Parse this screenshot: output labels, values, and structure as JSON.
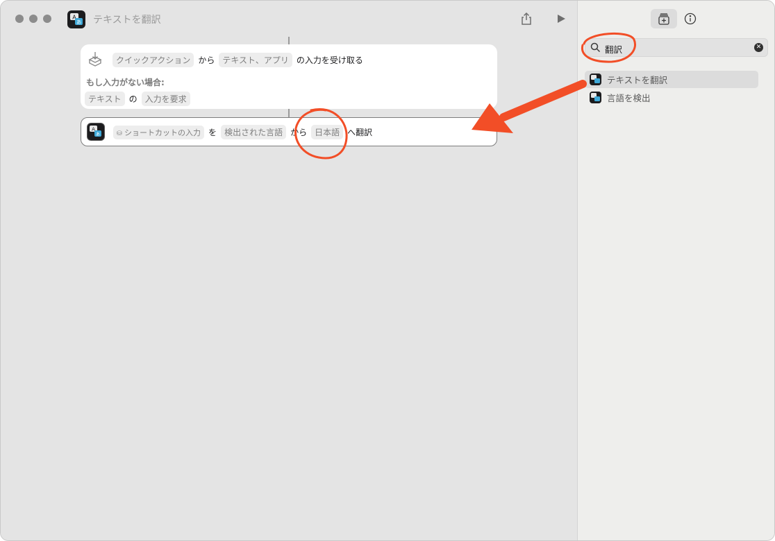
{
  "window": {
    "title": "テキストを翻訳"
  },
  "card_receive": {
    "tokens": [
      "クイックアクション",
      "から",
      "テキスト、アプリ",
      "の入力を受け取る"
    ],
    "no_input_label": "もし入力がない場合:",
    "fallback": [
      "テキスト",
      "の",
      "入力を要求"
    ]
  },
  "card_translate": {
    "tokens": [
      "ショートカットの入力",
      "を",
      "検出された言語",
      "から",
      "日本語",
      "へ翻訳"
    ]
  },
  "sidebar": {
    "search_value": "翻訳",
    "results": [
      "テキストを翻訳",
      "言語を検出"
    ]
  },
  "colors": {
    "annotation": "#f24e27",
    "accent_dark": "#1c1c1e"
  }
}
